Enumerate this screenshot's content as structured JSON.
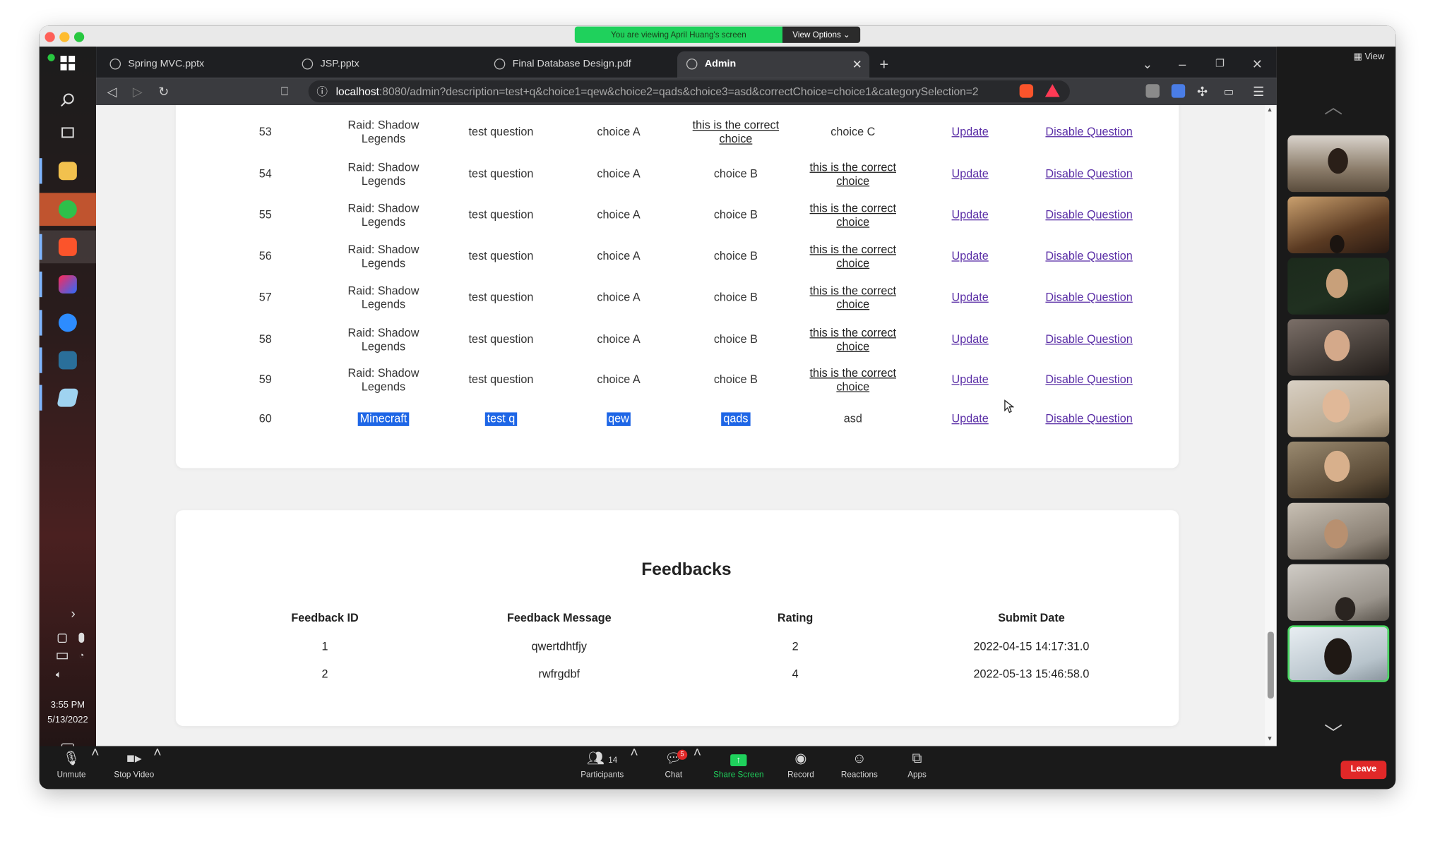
{
  "zoom": {
    "banner": "You are viewing April Huang's screen",
    "view_options": "View Options ⌄",
    "view_label": "View",
    "controls": [
      {
        "label": "Unmute",
        "icon": "microphone-muted-icon"
      },
      {
        "label": "Stop Video",
        "icon": "video-camera-icon"
      },
      {
        "label": "Participants",
        "icon": "participants-icon",
        "count": "14"
      },
      {
        "label": "Chat",
        "icon": "chat-icon",
        "badge": "5"
      },
      {
        "label": "Share Screen",
        "icon": "share-screen-icon"
      },
      {
        "label": "Record",
        "icon": "record-icon"
      },
      {
        "label": "Reactions",
        "icon": "reactions-icon"
      },
      {
        "label": "Apps",
        "icon": "apps-icon"
      }
    ],
    "leave": "Leave",
    "accent_share": "#1fd15c",
    "leave_color": "#e02828"
  },
  "taskbar": {
    "time": "3:55 PM",
    "date": "5/13/2022"
  },
  "browser": {
    "tabs": [
      {
        "title": "Spring MVC.pptx"
      },
      {
        "title": "JSP.pptx"
      },
      {
        "title": "Final Database Design.pdf"
      },
      {
        "title": "Admin"
      }
    ],
    "url_host": "localhost",
    "url_rest": ":8080/admin?description=test+q&choice1=qew&choice2=qads&choice3=asd&correctChoice=choice1&categorySelection=2"
  },
  "questions": {
    "rows": [
      {
        "id": "53",
        "category": "Raid: Shadow Legends",
        "description": "test question",
        "c1": "choice A",
        "c2": "this is the correct choice",
        "c3": "choice C",
        "update": "Update",
        "disable": "Disable Question"
      },
      {
        "id": "54",
        "category": "Raid: Shadow Legends",
        "description": "test question",
        "c1": "choice A",
        "c2": "choice B",
        "c3": "this is the correct choice",
        "update": "Update",
        "disable": "Disable Question"
      },
      {
        "id": "55",
        "category": "Raid: Shadow Legends",
        "description": "test question",
        "c1": "choice A",
        "c2": "choice B",
        "c3": "this is the correct choice",
        "update": "Update",
        "disable": "Disable Question"
      },
      {
        "id": "56",
        "category": "Raid: Shadow Legends",
        "description": "test question",
        "c1": "choice A",
        "c2": "choice B",
        "c3": "this is the correct choice",
        "update": "Update",
        "disable": "Disable Question"
      },
      {
        "id": "57",
        "category": "Raid: Shadow Legends",
        "description": "test question",
        "c1": "choice A",
        "c2": "choice B",
        "c3": "this is the correct choice",
        "update": "Update",
        "disable": "Disable Question"
      },
      {
        "id": "58",
        "category": "Raid: Shadow Legends",
        "description": "test question",
        "c1": "choice A",
        "c2": "choice B",
        "c3": "this is the correct choice",
        "update": "Update",
        "disable": "Disable Question"
      },
      {
        "id": "59",
        "category": "Raid: Shadow Legends",
        "description": "test question",
        "c1": "choice A",
        "c2": "choice B",
        "c3": "this is the correct choice",
        "update": "Update",
        "disable": "Disable Question"
      },
      {
        "id": "60",
        "category": "Minecraft",
        "description": "test q",
        "c1": "qew",
        "c2": "qads",
        "c3": "asd",
        "update": "Update",
        "disable": "Disable Question"
      }
    ]
  },
  "feedbacks": {
    "title": "Feedbacks",
    "headers": [
      "Feedback ID",
      "Feedback Message",
      "Rating",
      "Submit Date"
    ],
    "rows": [
      {
        "id": "1",
        "message": "qwertdhtfjy",
        "rating": "2",
        "date": "2022-04-15 14:17:31.0"
      },
      {
        "id": "2",
        "message": "rwfrgdbf",
        "rating": "4",
        "date": "2022-05-13 15:46:58.0"
      }
    ]
  }
}
